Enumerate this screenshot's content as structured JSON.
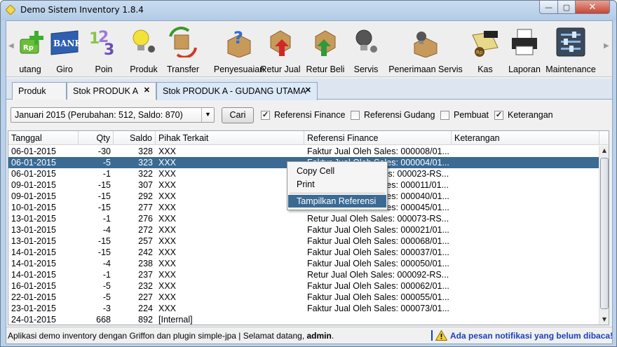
{
  "window": {
    "title": "Demo Sistem Inventory 1.8.4",
    "controls": {
      "minimize": "—",
      "maximize": "▢",
      "close": "✕"
    }
  },
  "toolbar": {
    "items": [
      {
        "label": "utang",
        "icon": "money-plus-icon"
      },
      {
        "label": "Giro",
        "icon": "bank-icon"
      },
      {
        "label": "Poin",
        "icon": "points-icon"
      },
      {
        "label": "Produk",
        "icon": "lightbulb-icon"
      },
      {
        "label": "Transfer",
        "icon": "transfer-icon"
      },
      {
        "label": "Penyesuaian",
        "icon": "question-box-icon"
      },
      {
        "label": "Retur Jual",
        "icon": "return-sale-icon"
      },
      {
        "label": "Retur Beli",
        "icon": "return-buy-icon"
      },
      {
        "label": "Servis",
        "icon": "service-bulb-icon"
      },
      {
        "label": "Penerimaan Servis",
        "icon": "service-receipt-icon"
      },
      {
        "label": "Kas",
        "icon": "cash-icon"
      },
      {
        "label": "Laporan",
        "icon": "printer-icon"
      },
      {
        "label": "Maintenance",
        "icon": "sliders-icon"
      }
    ]
  },
  "tabs": [
    {
      "label": "Produk"
    },
    {
      "label": "Stok PRODUK A"
    },
    {
      "label": "Stok PRODUK A - GUDANG UTAMA"
    }
  ],
  "tab_close_glyph": "✕",
  "filter": {
    "period": "Januari 2015 (Perubahan: 512, Saldo: 870)",
    "search_label": "Cari",
    "checkboxes": [
      {
        "label": "Referensi Finance",
        "checked": true
      },
      {
        "label": "Referensi Gudang",
        "checked": false
      },
      {
        "label": "Pembuat",
        "checked": false
      },
      {
        "label": "Keterangan",
        "checked": true
      }
    ]
  },
  "table": {
    "columns": [
      "Tanggal",
      "Qty",
      "Saldo",
      "Pihak Terkait",
      "Referensi Finance",
      "Keterangan"
    ],
    "selected_row": 1,
    "rows": [
      [
        "06-01-2015",
        "-30",
        "328",
        "XXX",
        "Faktur Jual Oleh Sales: 000008/01...",
        ""
      ],
      [
        "06-01-2015",
        "-5",
        "323",
        "XXX",
        "Faktur Jual Oleh Sales: 000004/01...",
        ""
      ],
      [
        "06-01-2015",
        "-1",
        "322",
        "XXX",
        "Retur Jual Oleh Sales: 000023-RS...",
        ""
      ],
      [
        "09-01-2015",
        "-15",
        "307",
        "XXX",
        "Faktur Jual Oleh Sales: 000011/01...",
        ""
      ],
      [
        "09-01-2015",
        "-15",
        "292",
        "XXX",
        "Faktur Jual Oleh Sales: 000040/01...",
        ""
      ],
      [
        "10-01-2015",
        "-15",
        "277",
        "XXX",
        "Faktur Jual Oleh Sales: 000045/01...",
        ""
      ],
      [
        "13-01-2015",
        "-1",
        "276",
        "XXX",
        "Retur Jual Oleh Sales: 000073-RS...",
        ""
      ],
      [
        "13-01-2015",
        "-4",
        "272",
        "XXX",
        "Faktur Jual Oleh Sales: 000021/01...",
        ""
      ],
      [
        "13-01-2015",
        "-15",
        "257",
        "XXX",
        "Faktur Jual Oleh Sales: 000068/01...",
        ""
      ],
      [
        "14-01-2015",
        "-15",
        "242",
        "XXX",
        "Faktur Jual Oleh Sales: 000037/01...",
        ""
      ],
      [
        "14-01-2015",
        "-4",
        "238",
        "XXX",
        "Faktur Jual Oleh Sales: 000050/01...",
        ""
      ],
      [
        "14-01-2015",
        "-1",
        "237",
        "XXX",
        "Retur Jual Oleh Sales: 000092-RS...",
        ""
      ],
      [
        "16-01-2015",
        "-5",
        "232",
        "XXX",
        "Faktur Jual Oleh Sales: 000062/01...",
        ""
      ],
      [
        "22-01-2015",
        "-5",
        "227",
        "XXX",
        "Faktur Jual Oleh Sales: 000055/01...",
        ""
      ],
      [
        "23-01-2015",
        "-3",
        "224",
        "XXX",
        "Faktur Jual Oleh Sales: 000073/01...",
        ""
      ],
      [
        "24-01-2015",
        "668",
        "892",
        "[Internal]",
        "",
        ""
      ]
    ]
  },
  "context_menu": {
    "items": [
      "Copy Cell",
      "Print",
      "Tampilkan Referensi"
    ],
    "highlighted": 2
  },
  "status": {
    "text_prefix": "Aplikasi demo inventory dengan Griffon dan plugin simple-jpa | Selamat datang, ",
    "user": "admin",
    "text_suffix": ".",
    "notification": "Ada pesan notifikasi yang belum dibaca!"
  },
  "colors": {
    "selection": "#3b6a93",
    "notification": "#1a3fbf"
  }
}
